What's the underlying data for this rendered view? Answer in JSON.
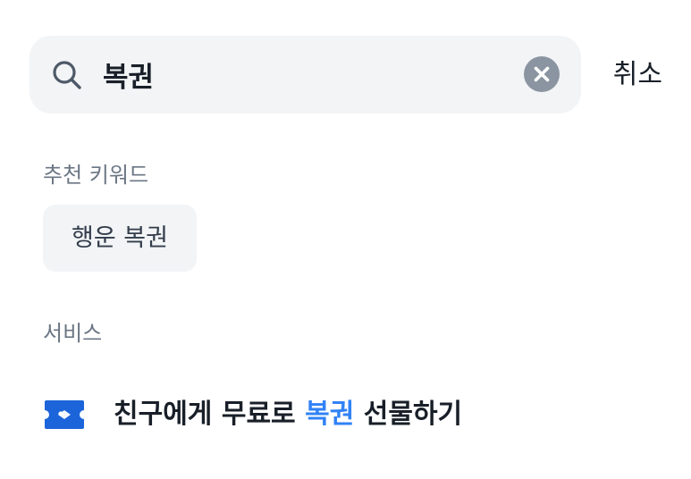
{
  "search": {
    "value": "복권",
    "icon": "search-icon",
    "clear_icon": "clear-icon",
    "cancel_label": "취소"
  },
  "recommended": {
    "title": "추천 키워드",
    "keywords": [
      "행운 복권"
    ]
  },
  "services": {
    "title": "서비스",
    "items": [
      {
        "icon": "ticket-icon",
        "label_before": "친구에게 무료로 ",
        "label_highlight": "복권",
        "label_after": " 선물하기"
      }
    ]
  },
  "colors": {
    "highlight": "#3182f6",
    "search_bg": "#f2f4f6",
    "chip_bg": "#f2f4f6",
    "clear_bg": "#8b95a1",
    "muted_text": "#6b7684",
    "primary_text": "#191f28"
  }
}
